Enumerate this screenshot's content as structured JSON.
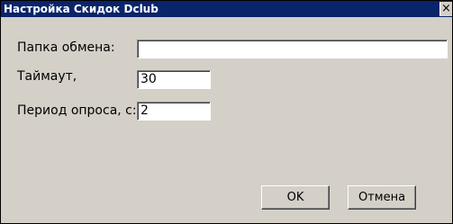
{
  "window": {
    "title": "Настройка Скидок Dclub",
    "close_glyph": "×"
  },
  "form": {
    "folder_label": "Папка обмена:",
    "folder_value": "",
    "timeout_label": "Таймаут,",
    "timeout_value": "30",
    "period_label": "Период опроса, с:",
    "period_value": "2"
  },
  "buttons": {
    "ok": "OK",
    "cancel": "Отмена"
  },
  "colors": {
    "titlebar": "#0a246a",
    "face": "#d4d0c8"
  }
}
